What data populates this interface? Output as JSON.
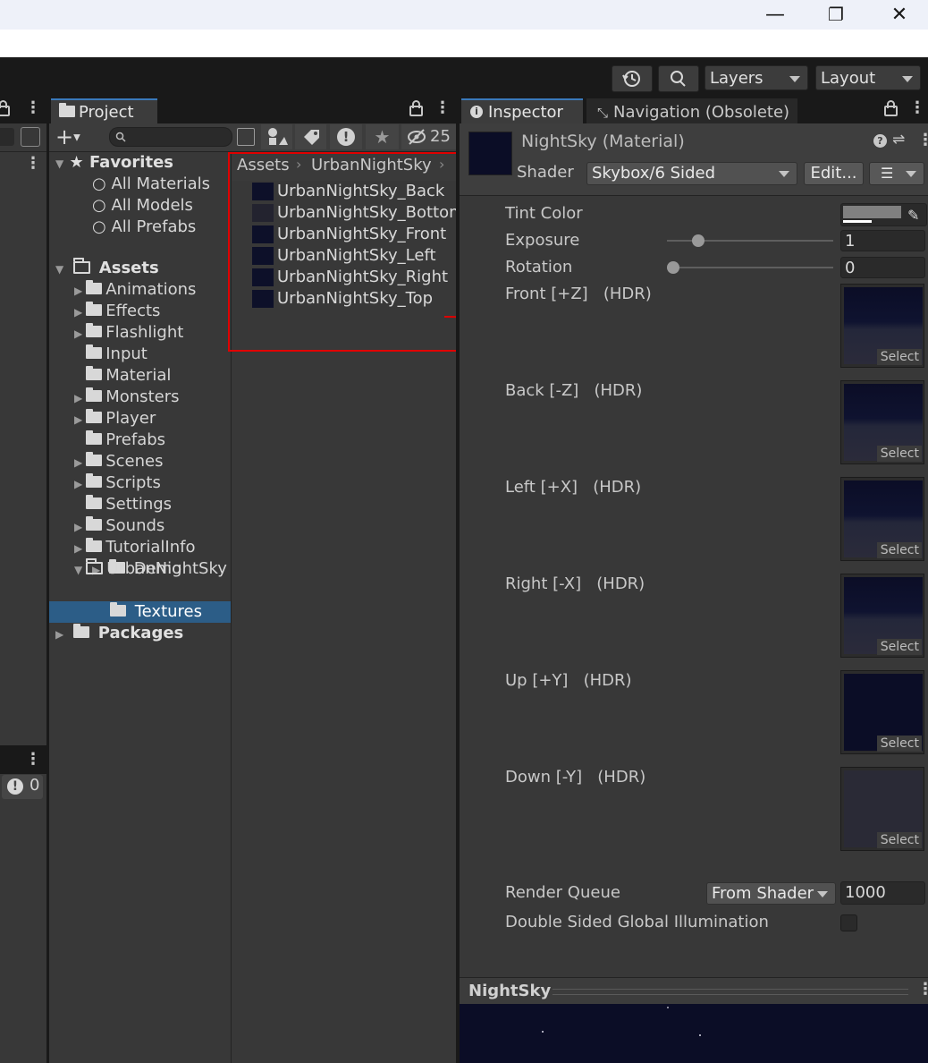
{
  "window": {
    "minimize": "—",
    "maximize": "❐",
    "close": "✕"
  },
  "toolbar": {
    "layers_label": "Layers",
    "layout_label": "Layout"
  },
  "left_panel": {
    "console_count": "0"
  },
  "project": {
    "tab_label": "Project",
    "hidden_count": "25",
    "favorites": {
      "label": "Favorites",
      "items": [
        "All Materials",
        "All Models",
        "All Prefabs"
      ]
    },
    "assets": {
      "label": "Assets",
      "children": [
        "Animations",
        "Effects",
        "Flashlight",
        "Input",
        "Material",
        "Monsters",
        "Player",
        "Prefabs",
        "Scenes",
        "Scripts",
        "Settings",
        "Sounds",
        "TutorialInfo",
        "UrbanNightSky"
      ],
      "urban_children": [
        "Demo",
        "Textures"
      ]
    },
    "packages_label": "Packages",
    "breadcrumb": [
      "Assets",
      "UrbanNightSky"
    ],
    "files": [
      "UrbanNightSky_Back",
      "UrbanNightSky_Bottom",
      "UrbanNightSky_Front",
      "UrbanNightSky_Left",
      "UrbanNightSky_Right",
      "UrbanNightSky_Top"
    ]
  },
  "inspector": {
    "tab_label": "Inspector",
    "nav_tab_label": "Navigation (Obsolete)",
    "material_title": "NightSky (Material)",
    "shader_label": "Shader",
    "shader_value": "Skybox/6 Sided",
    "edit_label": "Edit...",
    "tint_label": "Tint Color",
    "exposure_label": "Exposure",
    "exposure_value": "1",
    "exposure_level": 0.16,
    "rotation_label": "Rotation",
    "rotation_value": "0",
    "rotation_level": 0.0,
    "textures": [
      {
        "label": "Front [+Z]   (HDR)",
        "select": "Select"
      },
      {
        "label": "Back [-Z]   (HDR)",
        "select": "Select"
      },
      {
        "label": "Left [+X]   (HDR)",
        "select": "Select"
      },
      {
        "label": "Right [-X]   (HDR)",
        "select": "Select"
      },
      {
        "label": "Up [+Y]   (HDR)",
        "select": "Select"
      },
      {
        "label": "Down [-Y]   (HDR)",
        "select": "Select"
      }
    ],
    "render_queue_label": "Render Queue",
    "render_queue_mode": "From Shader",
    "render_queue_value": "1000",
    "double_sided_label": "Double Sided Global Illumination",
    "preview_title": "NightSky"
  },
  "colors": {
    "annotation": "#e00000",
    "selected_row": "#2c5d87",
    "tab_accent": "#3a79bb",
    "sky": "#0b0d26"
  }
}
